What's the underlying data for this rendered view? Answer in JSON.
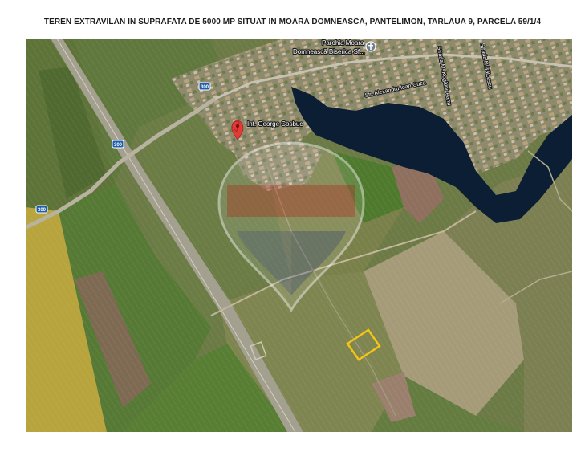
{
  "document": {
    "title": "TEREN EXTRAVILAN IN SUPRAFATA DE 5000 MP SITUAT IN MOARA DOMNEASCA, PANTELIMON, TARLAUA 9, PARCELA 59/1/4"
  },
  "map": {
    "type": "satellite",
    "pin_label": "Int. George Cosbuc",
    "poi_label_line1": "Parohia Moara",
    "poi_label_line2": "Domnească Biserica Sf...",
    "road_labels": {
      "alexandru": "Str. Alexandru Ioan Cuza",
      "kogalniceanu": "Strada M. Kogălniceanu",
      "balcescu": "Strada N.Bălcescu"
    },
    "road_shields": [
      "300",
      "300",
      "300"
    ],
    "parcel_outline_color": "#f2c418",
    "pin_color": "#e53935",
    "watermark": "real-estate-balloon-logo"
  }
}
